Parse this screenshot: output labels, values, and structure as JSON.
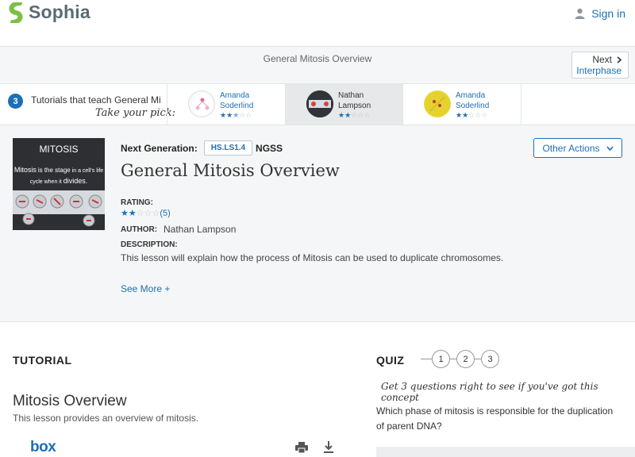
{
  "header": {
    "logo_text": "Sophia",
    "signin_label": "Sign in"
  },
  "strip": {
    "title": "General Mitosis Overview",
    "next_label": "Next",
    "next_sub": "Interphase"
  },
  "tutorials_bar": {
    "count": "3",
    "label": "Tutorials that teach General Mitosis Overview",
    "pick_label": "Take your pick:",
    "cards": [
      {
        "first": "Amanda",
        "last": "Soderlind",
        "rating": 2.5
      },
      {
        "first": "Nathan",
        "last": "Lampson",
        "rating": 2
      },
      {
        "first": "Amanda",
        "last": "Soderlind",
        "rating": 2
      }
    ]
  },
  "lesson": {
    "ngss_label": "Next Generation:",
    "ngss_code": "HS.LS1.4",
    "ngss_text": "NGSS",
    "other_actions_label": "Other Actions",
    "title": "General Mitosis Overview",
    "rating_label": "RATING:",
    "rating_value": 2,
    "rating_count": "(5)",
    "author_label": "AUTHOR:",
    "author_name": "Nathan Lampson",
    "description_label": "DESCRIPTION:",
    "description": "This lesson will explain how the process of Mitosis can be used to duplicate chromosomes.",
    "see_more_label": "See More +",
    "thumb_title": "MITOSIS",
    "thumb_line1_a": "Mitosis",
    "thumb_line1_b": "is the stage",
    "thumb_line1_c": "in a cell's life",
    "thumb_line2_a": "cycle when it",
    "thumb_line2_b": "divides."
  },
  "tutorial_section": {
    "heading": "TUTORIAL",
    "title": "Mitosis Overview",
    "subtitle": "This lesson provides an overview of mitosis.",
    "box_logo": "box"
  },
  "quiz": {
    "heading": "QUIZ",
    "steps": [
      "1",
      "2",
      "3"
    ],
    "hint": "Get 3 questions right to see if you've got this concept",
    "question": "Which phase of mitosis is responsible for the duplication of parent DNA?"
  },
  "colors": {
    "accent": "#1c6fb5",
    "strip_bg": "#f5f6f7",
    "logo_green": "#7ac143"
  },
  "icons": [
    "sophia-logo-icon",
    "user-icon",
    "chevron-right-icon",
    "chevron-down-icon",
    "star-icon",
    "print-icon",
    "download-icon"
  ]
}
